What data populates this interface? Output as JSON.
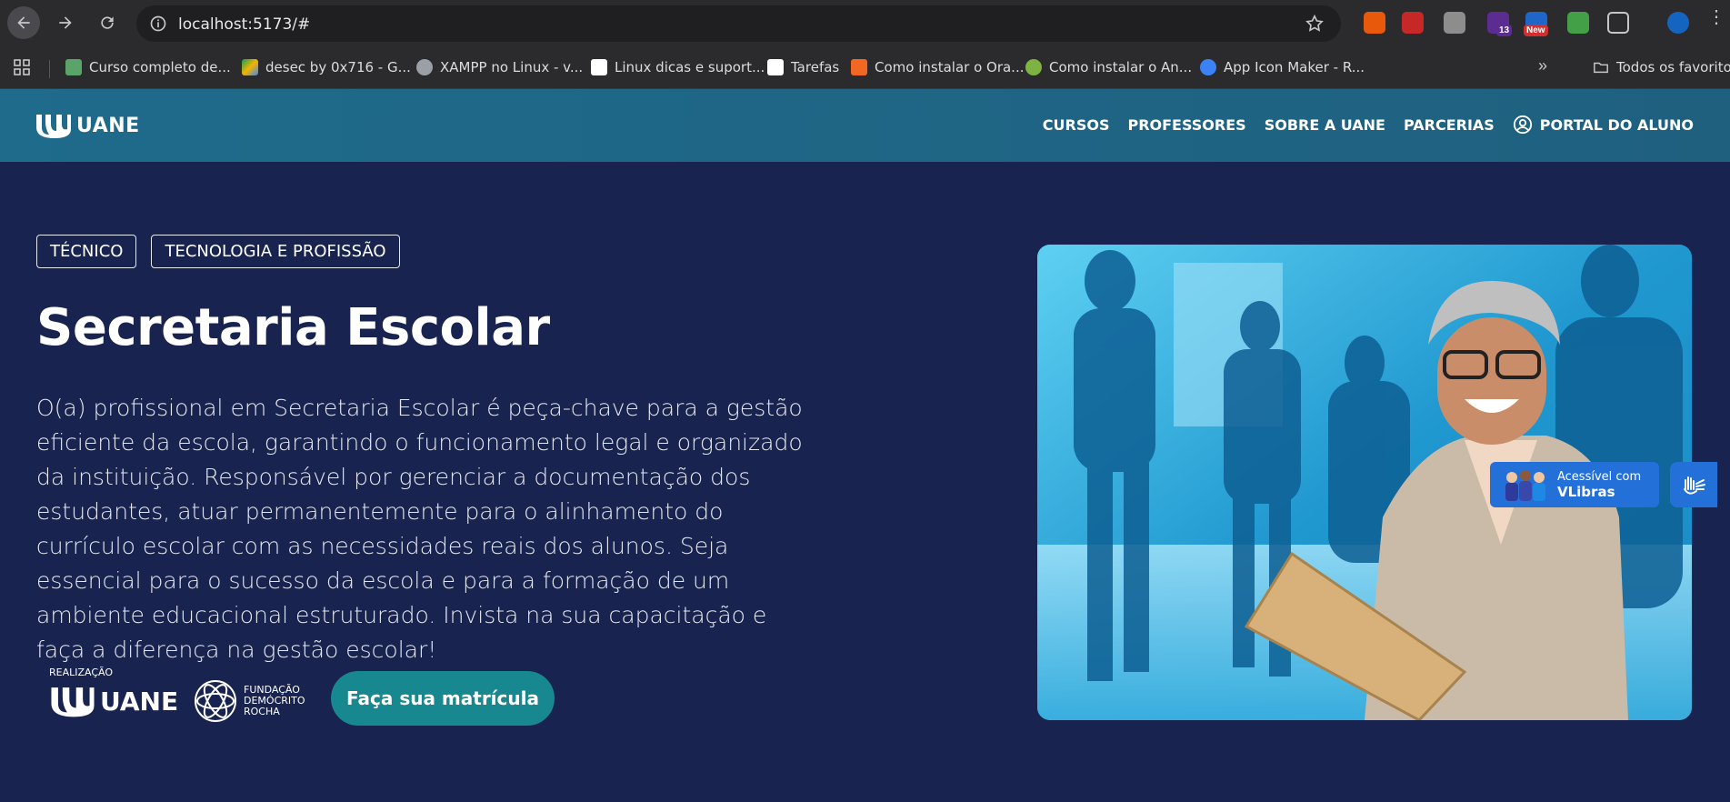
{
  "browser": {
    "url": "localhost:5173/#",
    "bookmarks": [
      {
        "label": "Curso completo de...",
        "color": "#5aa469"
      },
      {
        "label": "desec by 0x716 - G...",
        "color": "#f4b400"
      },
      {
        "label": "XAMPP no Linux - v...",
        "color": "#9aa0a6"
      },
      {
        "label": "Linux dicas e suport...",
        "color": "#ffffff"
      },
      {
        "label": "Tarefas",
        "color": "#ffffff"
      },
      {
        "label": "Como instalar o Ora...",
        "color": "#f26722"
      },
      {
        "label": "Como instalar o An...",
        "color": "#7cb342"
      },
      {
        "label": "App Icon Maker - R...",
        "color": "#3b82f6"
      }
    ],
    "all_bookmarks_label": "Todos os favoritos",
    "extension_badges": {
      "count": "13",
      "new": "New"
    }
  },
  "site": {
    "logo_text": "UANE",
    "nav": [
      "CURSOS",
      "PROFESSORES",
      "SOBRE A UANE",
      "PARCERIAS"
    ],
    "portal_label": "PORTAL DO ALUNO"
  },
  "hero": {
    "tags": [
      "TÉCNICO",
      "TECNOLOGIA E PROFISSÃO"
    ],
    "title": "Secretaria Escolar",
    "description": "O(a) profissional em Secretaria Escolar é peça-chave para a gestão eficiente da escola, garantindo o funcionamento legal e organizado da instituição. Responsável por gerenciar a documentação dos estudantes, atuar permanentemente para o alinhamento do currículo escolar com as necessidades reais dos alunos. Seja essencial para o sucesso da escola e para a formação de um ambiente educacional estruturado. Invista na sua capacitação e faça a diferença na gestão escolar!",
    "realizacao_label": "REALIZAÇÃO",
    "partner_uane": "UANE",
    "partner_fdr": [
      "FUNDAÇÃO",
      "DEMÓCRITO",
      "ROCHA"
    ],
    "cta_label": "Faça sua matrícula"
  },
  "vlibras": {
    "line1": "Acessível com",
    "line2": "VLibras"
  }
}
